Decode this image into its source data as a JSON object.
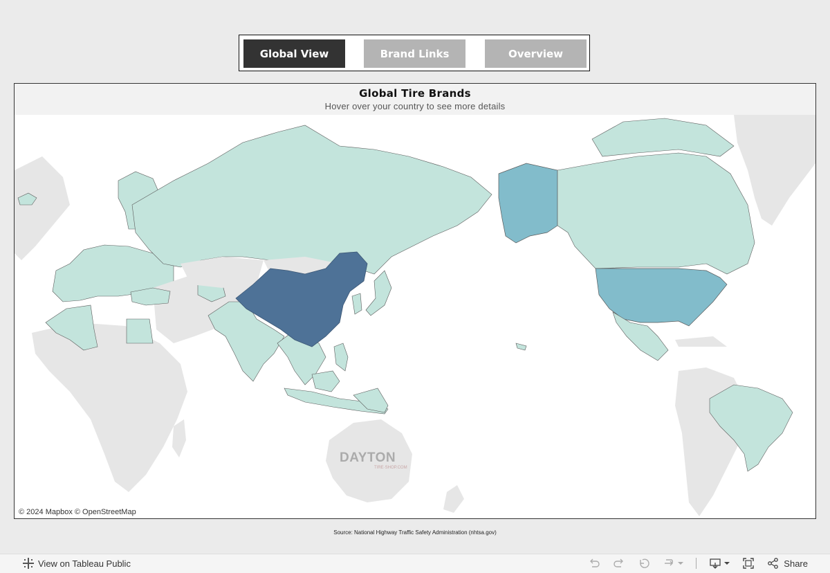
{
  "nav": {
    "buttons": [
      {
        "label": "Global View",
        "active": true
      },
      {
        "label": "Brand Links",
        "active": false
      },
      {
        "label": "Overview",
        "active": false
      }
    ]
  },
  "viz": {
    "title": "Global Tire Brands",
    "subtitle": "Hover over your country to see more details",
    "attribution": "© 2024 Mapbox  © OpenStreetMap",
    "watermark": "DAYTON",
    "watermark_sub": "TIRE·SHOP.COM"
  },
  "map": {
    "colors": {
      "ocean": "#ffffff",
      "no_data_land": "#e6e6e6",
      "level_1": "#c3e4dc",
      "level_2": "#82bccb",
      "level_3": "#4e7297",
      "border": "#5a5a5a"
    },
    "highlighted": [
      {
        "name": "China",
        "level": 3
      },
      {
        "name": "United States",
        "level": 2
      },
      {
        "name": "Alaska",
        "level": 2
      }
    ]
  },
  "source": "Source: National Highway Traffic Safety Administration (nhtsa.gov)",
  "footer": {
    "view_label": "View on Tableau Public",
    "share_label": "Share",
    "icons": [
      "undo-icon",
      "redo-icon",
      "revert-icon",
      "refresh-icon",
      "download-icon",
      "fullscreen-icon",
      "share-icon"
    ]
  }
}
